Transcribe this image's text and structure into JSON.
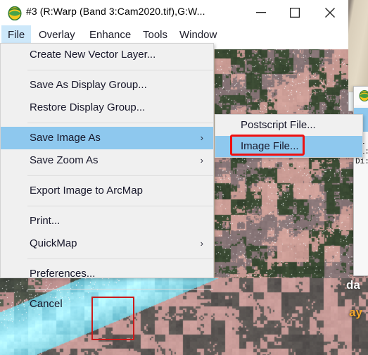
{
  "window": {
    "title": "#3 (R:Warp (Band 3:Cam2020.tif),G:W...",
    "icon": "envi-globe-icon",
    "controls": {
      "minimize": "minimize-button",
      "maximize": "maximize-button",
      "close": "close-button"
    }
  },
  "menubar": {
    "items": [
      {
        "label": "File",
        "active": true
      },
      {
        "label": "Overlay",
        "active": false
      },
      {
        "label": "Enhance",
        "active": false
      },
      {
        "label": "Tools",
        "active": false
      },
      {
        "label": "Window",
        "active": false
      }
    ]
  },
  "file_menu": {
    "items": [
      {
        "label": "Create New Vector Layer...",
        "submenu": false,
        "selected": false
      },
      {
        "label": "Save As Display Group...",
        "submenu": false,
        "selected": false
      },
      {
        "label": "Restore Display Group...",
        "submenu": false,
        "selected": false
      },
      {
        "label": "Save Image As",
        "submenu": true,
        "selected": true
      },
      {
        "label": "Save Zoom As",
        "submenu": true,
        "selected": false
      },
      {
        "label": "Export Image to ArcMap",
        "submenu": false,
        "selected": false
      },
      {
        "label": "Print...",
        "submenu": false,
        "selected": false
      },
      {
        "label": "QuickMap",
        "submenu": true,
        "selected": false
      },
      {
        "label": "Preferences...",
        "submenu": false,
        "selected": false
      },
      {
        "label": "Cancel",
        "submenu": false,
        "selected": false
      }
    ],
    "submenu_arrow": "›"
  },
  "save_image_submenu": {
    "items": [
      {
        "label": "Postscript File...",
        "selected": false
      },
      {
        "label": "Image File...",
        "selected": true
      }
    ]
  },
  "annotations": {
    "highlight_color": "#ee1111",
    "target_label": "Image File...",
    "image_roi_color": "#cc1a1a"
  },
  "side_window": {
    "text_lines": "LL\nDi:\nDi:"
  },
  "map_labels": {
    "white_fragment": "da",
    "orange_fragment": "ay"
  },
  "colors": {
    "menu_bg": "#f0f0f0",
    "selection_blue": "#8ec8ee",
    "menubar_active": "#cde8fa",
    "titlebar": "#ffffff"
  }
}
